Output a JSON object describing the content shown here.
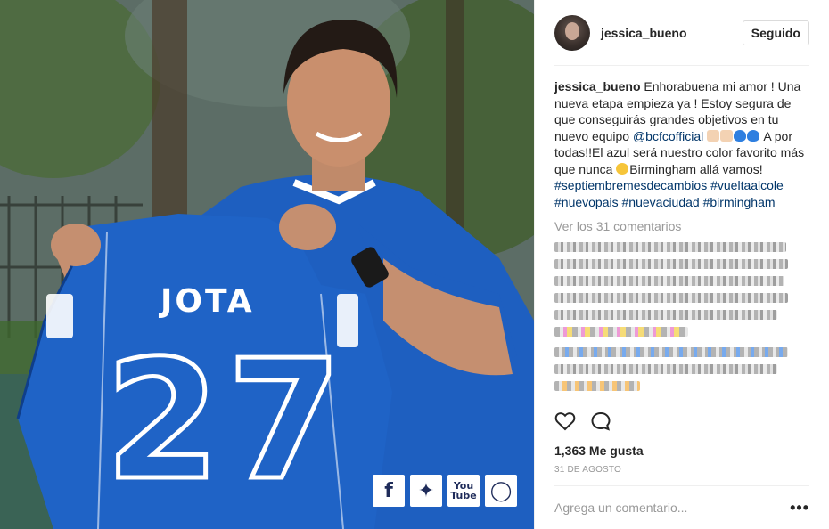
{
  "post": {
    "shirt_name": "JOTA",
    "shirt_number": "27",
    "social_icons": [
      "facebook-icon",
      "twitter-icon",
      "youtube-icon",
      "instagram-icon"
    ],
    "youtube_top": "You",
    "youtube_bottom": "Tube"
  },
  "header": {
    "username": "jessica_bueno",
    "follow_label": "Seguido"
  },
  "caption": {
    "author": "jessica_bueno",
    "part1": " Enhorabuena mi amor ! Una nueva etapa empieza ya ! Estoy segura de que conseguirás grandes objetivos en tu nuevo equipo ",
    "mention": "@bcfcofficial",
    "part2": "A por todas!!El azul será nuestro color favorito más que nunca ",
    "part3": "Birmingham allá vamos! ",
    "tag1": "#septiembremesdecambios",
    "tag2": "#vueltaalcole",
    "tag3": "#nuevopais",
    "tag4": "#nuevaciudad",
    "tag5": "#birmingham"
  },
  "view_comments": "Ver los 31 comentarios",
  "likes": "1,363 Me gusta",
  "date": "31 DE AGOSTO",
  "comment_input": {
    "placeholder": "Agrega un comentario..."
  },
  "more_options": "•••",
  "colors": {
    "jersey_blue": "#1e5fc0",
    "link_blue": "#003569",
    "muted_gray": "#999999"
  }
}
